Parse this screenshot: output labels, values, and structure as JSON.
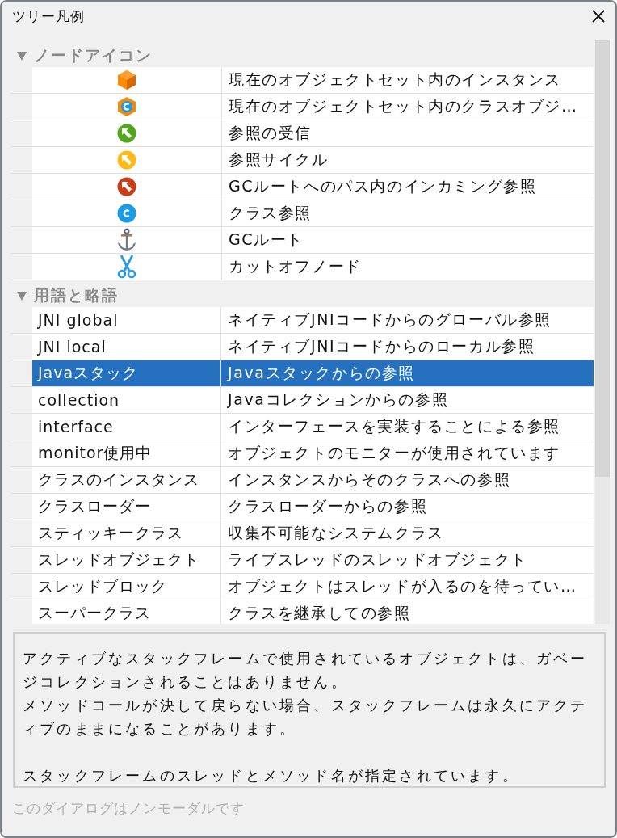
{
  "window": {
    "title": "ツリー凡例"
  },
  "sections": [
    {
      "title": "ノードアイコン",
      "expanded": true,
      "rows": [
        {
          "kind": "instance",
          "description": "現在のオブジェクトセット内のインスタンス",
          "selected": false
        },
        {
          "kind": "classobject",
          "description": "現在のオブジェクトセット内のクラスオブジ…",
          "selected": false
        },
        {
          "kind": "incoming",
          "description": "参照の受信",
          "selected": false
        },
        {
          "kind": "cycle",
          "description": "参照サイクル",
          "selected": false
        },
        {
          "kind": "gcpath",
          "description": "GCルートへのパス内のインカミング参照",
          "selected": false
        },
        {
          "kind": "classref",
          "description": "クラス参照",
          "selected": false
        },
        {
          "kind": "gcroot",
          "description": "GCルート",
          "selected": false
        },
        {
          "kind": "cutoff",
          "description": "カットオフノード",
          "selected": false
        }
      ]
    },
    {
      "title": "用語と略語",
      "expanded": true,
      "rows": [
        {
          "term": "JNI global",
          "description": "ネイティブJNIコードからのグローバル参照",
          "selected": false
        },
        {
          "term": "JNI local",
          "description": "ネイティブJNIコードからのローカル参照",
          "selected": false
        },
        {
          "term": "Javaスタック",
          "description": "Javaスタックからの参照",
          "selected": true
        },
        {
          "term": "collection",
          "description": "Javaコレクションからの参照",
          "selected": false
        },
        {
          "term": "interface",
          "description": "インターフェースを実装することによる参照",
          "selected": false
        },
        {
          "term": "monitor使用中",
          "description": "オブジェクトのモニターが使用されています",
          "selected": false
        },
        {
          "term": "クラスのインスタンス",
          "description": "インスタンスからそのクラスへの参照",
          "selected": false
        },
        {
          "term": "クラスローダー",
          "description": "クラスローダーからの参照",
          "selected": false
        },
        {
          "term": "スティッキークラス",
          "description": "収集不可能なシステムクラス",
          "selected": false
        },
        {
          "term": "スレッドオブジェクト",
          "description": "ライブスレッドのスレッドオブジェクト",
          "selected": false
        },
        {
          "term": "スレッドブロック",
          "description": "オブジェクトはスレッドが入るのを待ってい…",
          "selected": false
        },
        {
          "term": "スーパークラス",
          "description": "クラスを継承しての参照",
          "selected": false
        }
      ]
    }
  ],
  "details": {
    "blocks": [
      [
        "アクティブなスタックフレームで使用されているオブジェクトは、ガベージコレクションされることはありません。",
        "メソッドコールが決して戻らない場合、スタックフレームは永久にアクティブのままになることがあります。"
      ],
      [
        "スタックフレームのスレッドとメソッド名が指定されています。"
      ]
    ]
  },
  "footer": "このダイアログはノンモーダルです"
}
